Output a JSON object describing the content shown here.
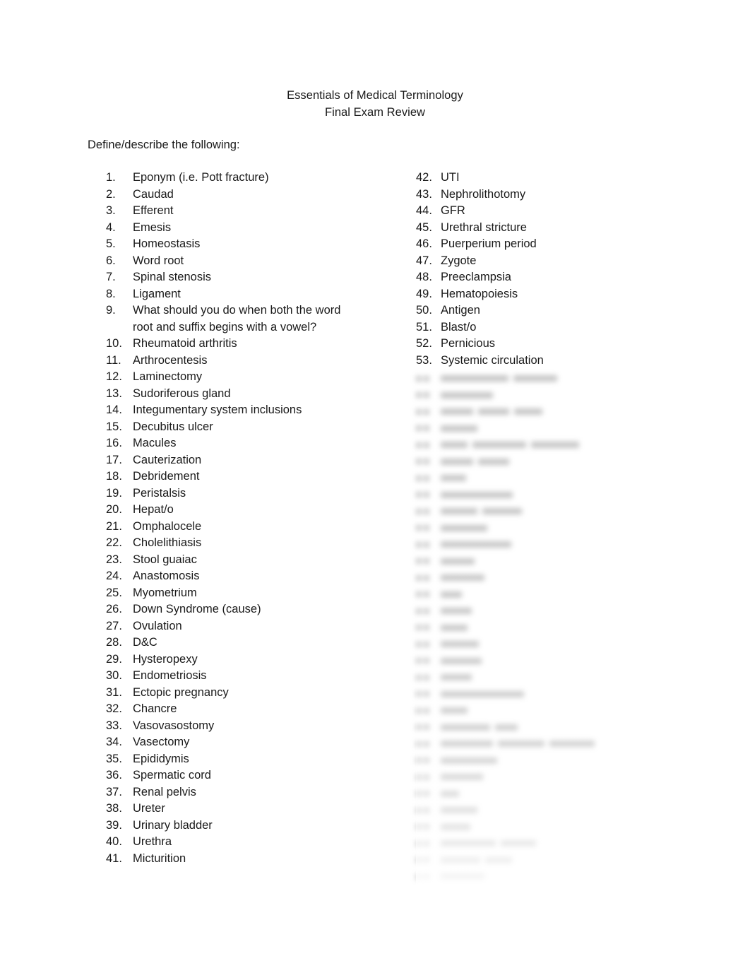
{
  "document": {
    "title_line_1": "Essentials of Medical Terminology",
    "title_line_2": "Final Exam Review",
    "instruction": "Define/describe the following:",
    "text_color": "#1a1a1a",
    "background_color": "#ffffff"
  },
  "left_column": {
    "items": [
      {
        "number": "1.",
        "text": "Eponym (i.e. Pott fracture)"
      },
      {
        "number": "2.",
        "text": "Caudad"
      },
      {
        "number": "3.",
        "text": "Efferent"
      },
      {
        "number": "4.",
        "text": "Emesis"
      },
      {
        "number": "5.",
        "text": "Homeostasis"
      },
      {
        "number": "6.",
        "text": "Word root"
      },
      {
        "number": "7.",
        "text": "Spinal stenosis"
      },
      {
        "number": "8.",
        "text": "Ligament"
      },
      {
        "number": "9.",
        "text": "What should you do when both the word root and suffix begins with a vowel?"
      },
      {
        "number": "10.",
        "text": "Rheumatoid arthritis"
      },
      {
        "number": "11.",
        "text": "Arthrocentesis"
      },
      {
        "number": "12.",
        "text": "Laminectomy"
      },
      {
        "number": "13.",
        "text": "Sudoriferous gland"
      },
      {
        "number": "14.",
        "text": "Integumentary system inclusions"
      },
      {
        "number": "15.",
        "text": "Decubitus ulcer"
      },
      {
        "number": "16.",
        "text": "Macules"
      },
      {
        "number": "17.",
        "text": "Cauterization"
      },
      {
        "number": "18.",
        "text": "Debridement"
      },
      {
        "number": "19.",
        "text": "Peristalsis"
      },
      {
        "number": "20.",
        "text": "Hepat/o"
      },
      {
        "number": "21.",
        "text": "Omphalocele"
      },
      {
        "number": "22.",
        "text": "Cholelithiasis"
      },
      {
        "number": "23.",
        "text": "Stool guaiac"
      },
      {
        "number": "24.",
        "text": "Anastomosis"
      },
      {
        "number": "25.",
        "text": "Myometrium"
      },
      {
        "number": "26.",
        "text": "Down Syndrome (cause)"
      },
      {
        "number": "27.",
        "text": "Ovulation"
      },
      {
        "number": "28.",
        "text": "D&C"
      },
      {
        "number": "29.",
        "text": "Hysteropexy"
      },
      {
        "number": "30.",
        "text": "Endometriosis"
      },
      {
        "number": "31.",
        "text": "Ectopic pregnancy"
      },
      {
        "number": "32.",
        "text": "Chancre"
      },
      {
        "number": "33.",
        "text": "Vasovasostomy"
      },
      {
        "number": "34.",
        "text": "Vasectomy"
      },
      {
        "number": "35.",
        "text": "Epididymis"
      },
      {
        "number": "36.",
        "text": "Spermatic cord"
      },
      {
        "number": "37.",
        "text": "Renal pelvis"
      },
      {
        "number": "38.",
        "text": "Ureter"
      },
      {
        "number": "39.",
        "text": "Urinary bladder"
      },
      {
        "number": "40.",
        "text": "Urethra"
      },
      {
        "number": "41.",
        "text": "Micturition"
      }
    ]
  },
  "right_column": {
    "items": [
      {
        "number": "42.",
        "text": "UTI"
      },
      {
        "number": "43.",
        "text": "Nephrolithotomy"
      },
      {
        "number": "44.",
        "text": "GFR"
      },
      {
        "number": "45.",
        "text": "Urethral stricture"
      },
      {
        "number": "46.",
        "text": "Puerperium period"
      },
      {
        "number": "47.",
        "text": "Zygote"
      },
      {
        "number": "48.",
        "text": "Preeclampsia"
      },
      {
        "number": "49.",
        "text": "Hematopoiesis"
      },
      {
        "number": "50.",
        "text": "Antigen"
      },
      {
        "number": "51.",
        "text": "Blast/o"
      },
      {
        "number": "52.",
        "text": "Pernicious"
      },
      {
        "number": "53.",
        "text": "Systemic circulation"
      }
    ]
  },
  "obscured_preview": {
    "description": "Remaining list items are obscured by a preview blur and are not legible.",
    "legible": false,
    "row_word_widths": [
      [
        96,
        62
      ],
      [
        74
      ],
      [
        46,
        44,
        40
      ],
      [
        52
      ],
      [
        38,
        76,
        68
      ],
      [
        46,
        44
      ],
      [
        36
      ],
      [
        102
      ],
      [
        52,
        56
      ],
      [
        66
      ],
      [
        100
      ],
      [
        48
      ],
      [
        62
      ],
      [
        30
      ],
      [
        44
      ],
      [
        38
      ],
      [
        54
      ],
      [
        58
      ],
      [
        44
      ],
      [
        118
      ],
      [
        38
      ],
      [
        70,
        32
      ],
      [
        74,
        66,
        64
      ],
      [
        80
      ],
      [
        60
      ],
      [
        26
      ],
      [
        52
      ],
      [
        42
      ],
      [
        78,
        50
      ],
      [
        56,
        38
      ],
      [
        62
      ]
    ]
  }
}
